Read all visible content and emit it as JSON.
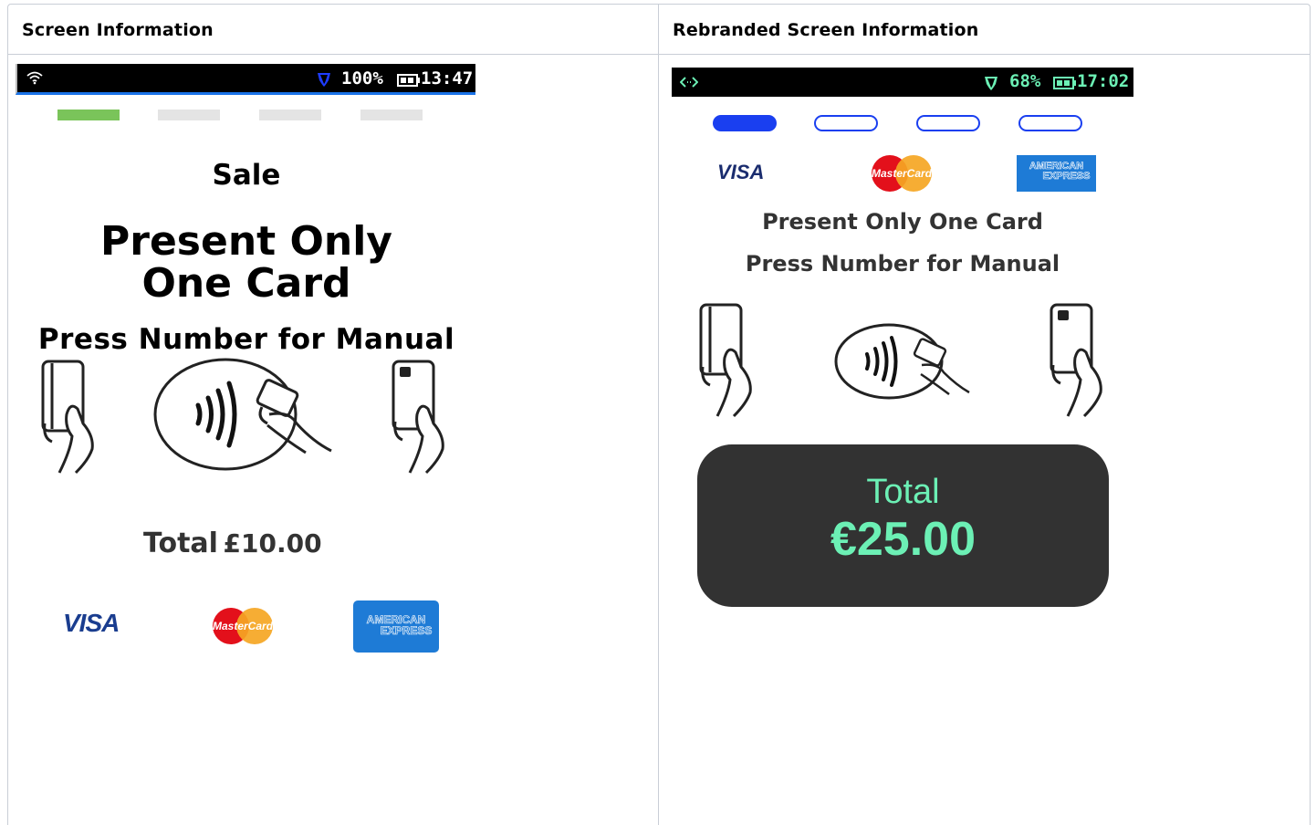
{
  "headers": {
    "left": "Screen Information",
    "right": "Rebranded Screen Information"
  },
  "original": {
    "status": {
      "battery": "100%",
      "time": "13:47",
      "icons": [
        "wifi-icon",
        "shield-icon",
        "battery-icon"
      ]
    },
    "progress_active_color": "#7ac45a",
    "progress_inactive_color": "#e4e4e4",
    "title": "Sale",
    "prompt": "Present Only One Card",
    "manual": "Press Number for Manual",
    "total_label": "Total",
    "total_amount": "£10.00",
    "card_logos": {
      "visa": "VISA",
      "mastercard": "MasterCard",
      "amex_line1": "AMERICAN",
      "amex_line2": "EXPRESS"
    }
  },
  "rebranded": {
    "status": {
      "battery": "68%",
      "time": "17:02",
      "icons": [
        "nfc-arrows-icon",
        "shield-icon",
        "battery-icon"
      ]
    },
    "accent_color": "#6cf0b5",
    "pill_active_color": "#1a3ff0",
    "prompt": "Present Only One Card",
    "manual": "Press Number for Manual",
    "total_label": "Total",
    "total_amount": "€25.00",
    "card_logos": {
      "visa": "VISA",
      "mastercard": "MasterCard",
      "amex_line1": "AMERICAN",
      "amex_line2": "EXPRESS"
    }
  }
}
